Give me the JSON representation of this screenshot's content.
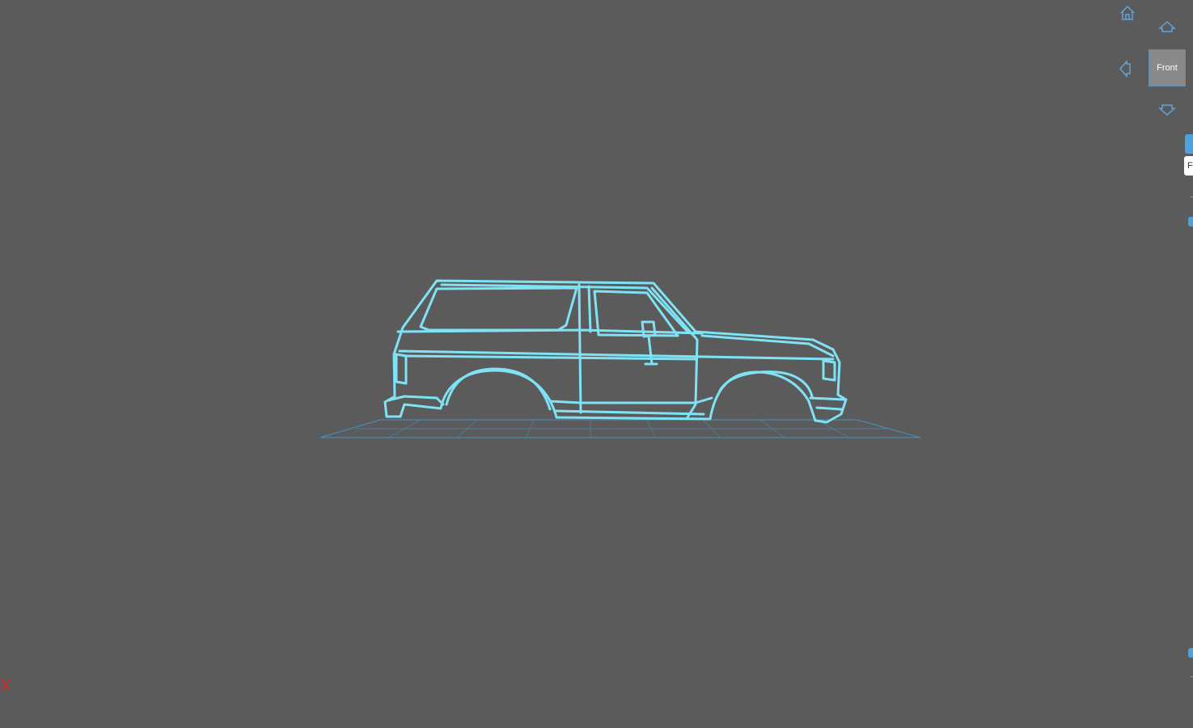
{
  "viewer": {
    "background": "#5b5b5b",
    "wire_color": "#7fe3f5",
    "grid_color": "#3fa0d8"
  },
  "nav": {
    "home_icon": "home-icon",
    "up_icon": "arrow-up-icon",
    "left_icon": "arrow-left-icon",
    "down_icon": "arrow-down-icon"
  },
  "viewcube": {
    "face_label": "Front"
  },
  "side_panel": {
    "chip_label": "F"
  },
  "axis": {
    "label": "X"
  }
}
